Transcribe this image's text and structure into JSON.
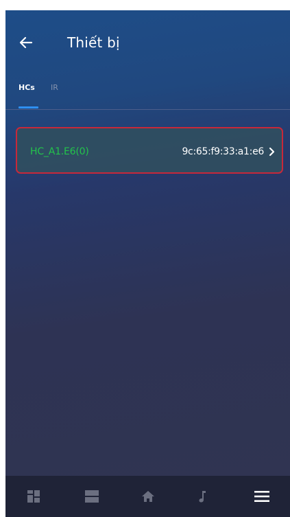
{
  "header": {
    "title": "Thiết bị",
    "back_icon": "arrow-left-icon"
  },
  "tabs": [
    {
      "label": "HCs",
      "active": true
    },
    {
      "label": "IR",
      "active": false
    }
  ],
  "devices": [
    {
      "name": "HC_A1.E6(0)",
      "mac": "9c:65:f9:33:a1:e6",
      "icon": "chevron-right-icon",
      "highlighted": true
    }
  ],
  "bottom_nav": [
    {
      "icon": "dashboard-icon"
    },
    {
      "icon": "list-icon"
    },
    {
      "icon": "home-icon"
    },
    {
      "icon": "music-note-icon"
    },
    {
      "icon": "menu-icon"
    }
  ],
  "colors": {
    "accent": "#2f8ff1",
    "device_name": "#23c44b",
    "highlight_border": "#c8283a",
    "nav_background": "#1f2337"
  }
}
